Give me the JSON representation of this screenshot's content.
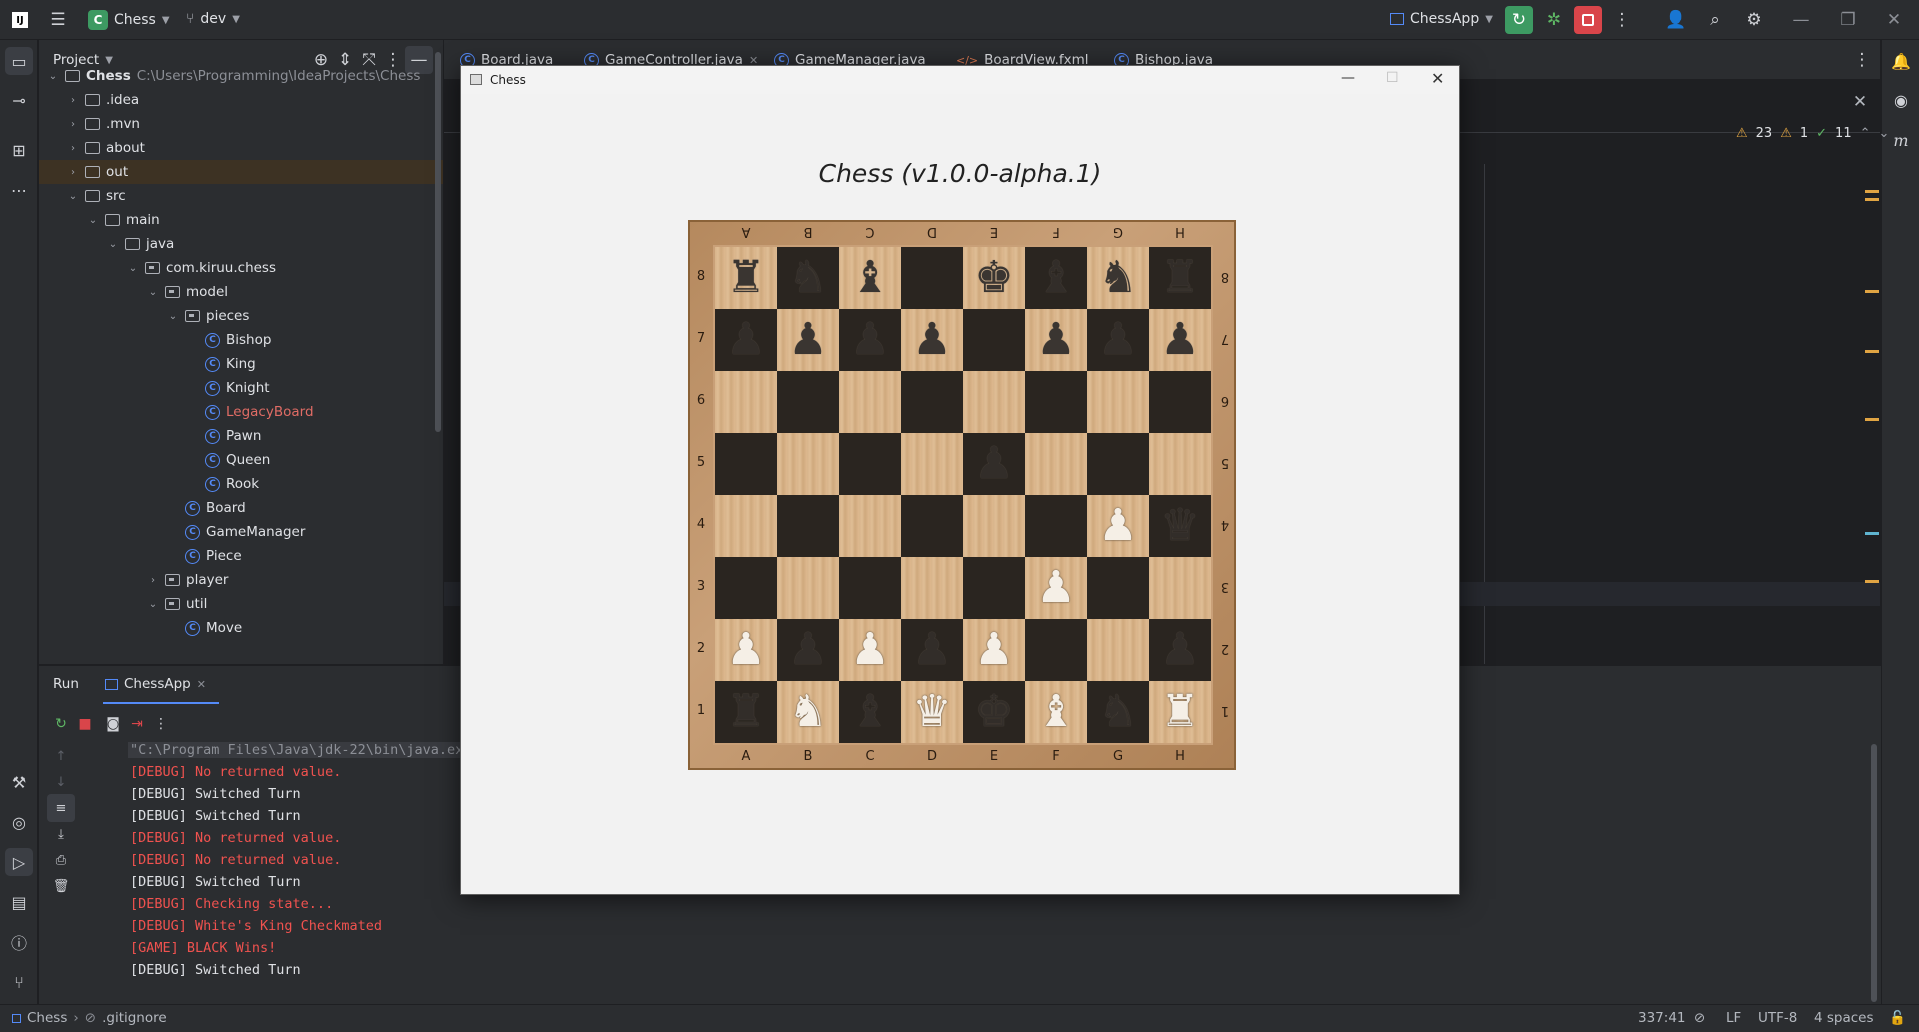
{
  "topbar": {
    "project_badge": "C",
    "project_name": "Chess",
    "branch": "dev",
    "run_config": "ChessApp"
  },
  "project_panel": {
    "title": "Project",
    "root_name": "Chess",
    "root_path": "C:\\Users\\Programming\\IdeaProjects\\Chess",
    "items": [
      {
        "label": ".idea",
        "kind": "folder"
      },
      {
        "label": ".mvn",
        "kind": "folder"
      },
      {
        "label": "about",
        "kind": "folder"
      },
      {
        "label": "out",
        "kind": "folder"
      },
      {
        "label": "src",
        "kind": "folder"
      },
      {
        "label": "main",
        "kind": "folder"
      },
      {
        "label": "java",
        "kind": "folder"
      },
      {
        "label": "com.kiruu.chess",
        "kind": "package"
      },
      {
        "label": "model",
        "kind": "package"
      },
      {
        "label": "pieces",
        "kind": "package"
      },
      {
        "label": "Bishop",
        "kind": "class"
      },
      {
        "label": "King",
        "kind": "class"
      },
      {
        "label": "Knight",
        "kind": "class"
      },
      {
        "label": "LegacyBoard",
        "kind": "class",
        "color": "#e06c65"
      },
      {
        "label": "Pawn",
        "kind": "class"
      },
      {
        "label": "Queen",
        "kind": "class"
      },
      {
        "label": "Rook",
        "kind": "class"
      },
      {
        "label": "Board",
        "kind": "class"
      },
      {
        "label": "GameManager",
        "kind": "class"
      },
      {
        "label": "Piece",
        "kind": "class"
      },
      {
        "label": "player",
        "kind": "package"
      },
      {
        "label": "util",
        "kind": "package"
      },
      {
        "label": "Move",
        "kind": "class"
      }
    ]
  },
  "editor": {
    "tabs": [
      "Board.java",
      "GameController.java",
      "GameManager.java",
      "BoardView.fxml",
      "Bishop.java"
    ],
    "inspections": {
      "warnings": "23",
      "weak_warnings": "1",
      "ok": "11"
    }
  },
  "run_panel": {
    "title": "Run",
    "tab": "ChessApp",
    "console": [
      {
        "text": "\"C:\\Program Files\\Java\\jdk-22\\bin\\java.exe\" ...",
        "color": "#8c8f96"
      },
      {
        "text": "[DEBUG] No returned value.",
        "color": "#f0524f"
      },
      {
        "text": "[DEBUG] Switched Turn",
        "color": "#dfe1e5"
      },
      {
        "text": "[DEBUG] Switched Turn",
        "color": "#dfe1e5"
      },
      {
        "text": "[DEBUG] No returned value.",
        "color": "#f0524f"
      },
      {
        "text": "[DEBUG] No returned value.",
        "color": "#f0524f"
      },
      {
        "text": "[DEBUG] Switched Turn",
        "color": "#dfe1e5"
      },
      {
        "text": "[DEBUG] Checking state...",
        "color": "#f0524f"
      },
      {
        "text": "[DEBUG] White's King Checkmated",
        "color": "#f0524f"
      },
      {
        "text": "[GAME] BLACK Wins!",
        "color": "#f0524f"
      },
      {
        "text": "[DEBUG] Switched Turn",
        "color": "#dfe1e5"
      }
    ]
  },
  "statusbar": {
    "project": "Chess",
    "file": ".gitignore",
    "position": "337:41",
    "line_sep": "LF",
    "encoding": "UTF-8",
    "indent": "4 spaces"
  },
  "chess_window": {
    "title": "Chess",
    "heading": "Chess (v1.0.0-alpha.1)",
    "files": [
      "A",
      "B",
      "C",
      "D",
      "E",
      "F",
      "G",
      "H"
    ],
    "ranks": [
      "8",
      "7",
      "6",
      "5",
      "4",
      "3",
      "2",
      "1"
    ],
    "board": [
      [
        "bR",
        "bN",
        "bB",
        "",
        "bK",
        "bB",
        "bN",
        "bR"
      ],
      [
        "bP",
        "bP",
        "bP",
        "bP",
        "",
        "bP",
        "bP",
        "bP"
      ],
      [
        "",
        "",
        "",
        "",
        "",
        "",
        "",
        ""
      ],
      [
        "",
        "",
        "",
        "",
        "bP",
        "",
        "",
        ""
      ],
      [
        "",
        "",
        "",
        "",
        "",
        "",
        "wP",
        "bQ"
      ],
      [
        "",
        "",
        "",
        "",
        "",
        "wP",
        "",
        ""
      ],
      [
        "wP",
        "bP",
        "wP",
        "bP",
        "wP",
        "",
        "",
        "bP"
      ],
      [
        "bR",
        "wN",
        "bB",
        "wQ",
        "bK",
        "wB",
        "bN",
        "wR"
      ]
    ]
  },
  "colors": {
    "ide_bg": "#1e1f22",
    "panel_bg": "#2b2d30",
    "accent_blue": "#548af7",
    "error_red": "#f0524f",
    "run_green": "#3d9a62"
  }
}
